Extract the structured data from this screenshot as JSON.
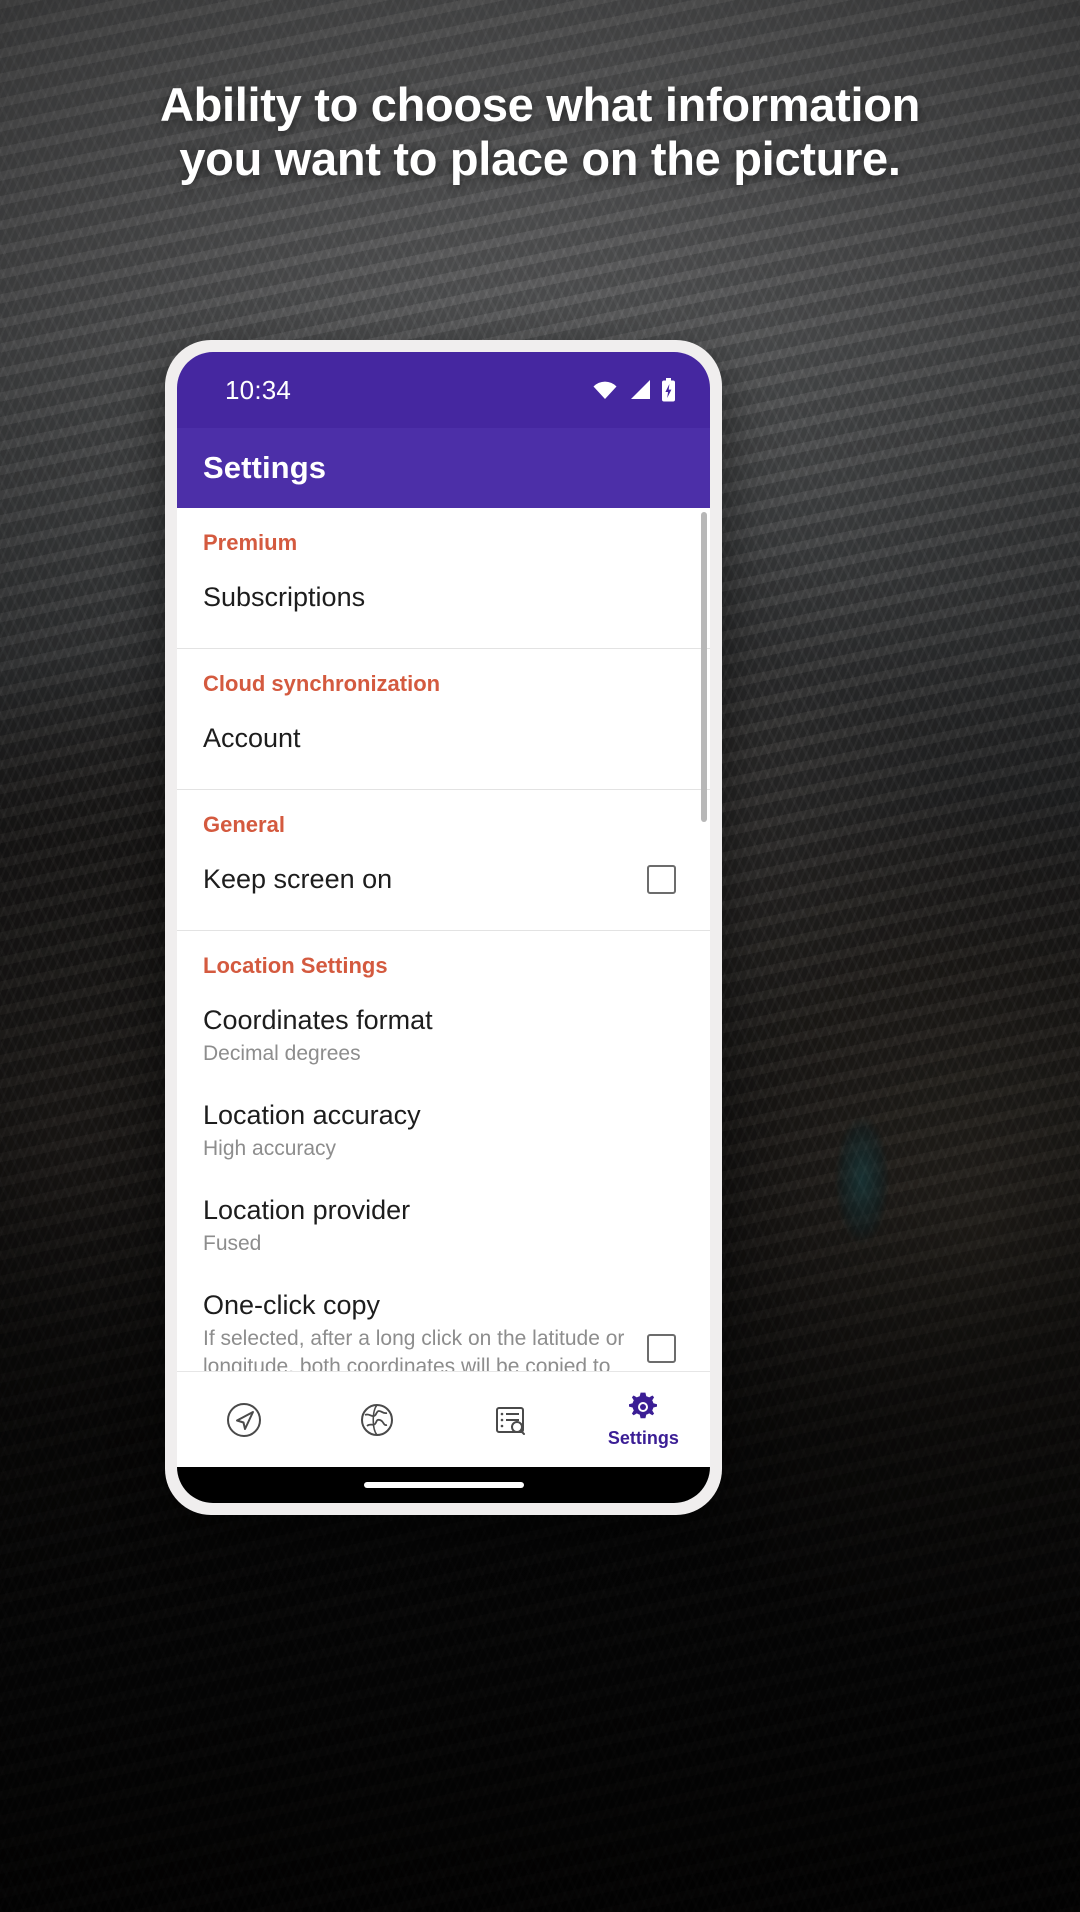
{
  "headline": "Ability to choose what information you want to place on the picture.",
  "colors": {
    "status_bar": "#4527A0",
    "app_bar": "#4C2FA8",
    "section_title": "#D45A3F",
    "active_nav": "#3B1E95",
    "row_title": "#1D1D1D",
    "row_subtitle": "#8D8D8D"
  },
  "statusbar": {
    "time": "10:34",
    "icons": [
      "wifi-icon",
      "cellular-signal-icon",
      "battery-icon"
    ]
  },
  "appbar": {
    "title": "Settings"
  },
  "sections": [
    {
      "title": "Premium",
      "rows": [
        {
          "title": "Subscriptions",
          "subtitle": "",
          "checkbox": false
        }
      ]
    },
    {
      "title": "Cloud synchronization",
      "rows": [
        {
          "title": "Account",
          "subtitle": "",
          "checkbox": false
        }
      ]
    },
    {
      "title": "General",
      "rows": [
        {
          "title": "Keep screen on",
          "subtitle": "",
          "checkbox": true,
          "checked": false
        }
      ]
    },
    {
      "title": "Location Settings",
      "rows": [
        {
          "title": "Coordinates format",
          "subtitle": "Decimal degrees",
          "checkbox": false
        },
        {
          "title": "Location accuracy",
          "subtitle": "High accuracy",
          "checkbox": false
        },
        {
          "title": "Location provider",
          "subtitle": "Fused",
          "checkbox": false
        },
        {
          "title": "One-click copy",
          "subtitle": "If selected, after a long click on the latitude or longitude, both coordinates will be copied to the clipboard separated by a comma",
          "checkbox": true,
          "checked": false
        }
      ]
    }
  ],
  "bottom_nav": {
    "items": [
      {
        "icon": "compass-navigation-icon",
        "label": "",
        "active": false
      },
      {
        "icon": "globe-icon",
        "label": "",
        "active": false
      },
      {
        "icon": "list-search-icon",
        "label": "",
        "active": false
      },
      {
        "icon": "gear-icon",
        "label": "Settings",
        "active": true
      }
    ]
  }
}
